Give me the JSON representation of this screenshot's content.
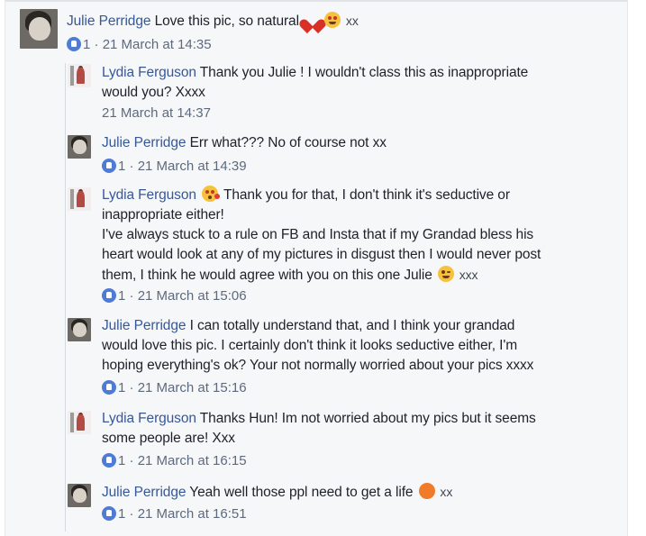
{
  "comments": [
    {
      "author": "Julie Perridge",
      "text": " Love this pic, so natural ",
      "trail": " xx",
      "likes": "1",
      "time": "21 March at 14:35"
    },
    {
      "author": "Lydia Ferguson",
      "line1": " Thank you Julie ! I wouldn't class this as inappropriate",
      "line2": "would you? Xxxx",
      "time": "21 March at 14:37"
    },
    {
      "author": "Julie Perridge",
      "text": " Err what??? No of course not xx",
      "likes": "1",
      "time": "21 March at 14:39"
    },
    {
      "author": "Lydia Ferguson",
      "line1": " Thank you for that, I don't think it's seductive or",
      "line2": "inappropriate either!",
      "line3": "I've always stuck to a rule on FB and Insta that if my Grandad bless his",
      "line4": "heart would look at any of my pictures in disgust then I would never post",
      "line5": "them, I think he would agree with you on this one Julie ",
      "line5_trail": " xxx",
      "likes": "1",
      "time": "21 March at 15:06"
    },
    {
      "author": "Julie Perridge",
      "line1": " I can totally understand that, and I think your grandad",
      "line2": "would love this pic. I certainly don't think it looks seductive either, I'm",
      "line3": "hoping everything's ok? Your not normally worried about your pics xxxx",
      "likes": "1",
      "time": "21 March at 15:16"
    },
    {
      "author": "Lydia Ferguson",
      "line1": " Thanks Hun! Im not worried about my pics but it seems",
      "line2": "some people are! Xxx",
      "likes": "1",
      "time": "21 March at 16:15"
    },
    {
      "author": "Julie Perridge",
      "text": " Yeah well those ppl need to get a life ",
      "trail": " xx",
      "likes": "1",
      "time": "21 March at 16:51"
    }
  ],
  "meta_separator": " · ",
  "icons": {
    "like": "like-badge-icon",
    "heart": "red-heart-emoji",
    "heart_eyes": "heart-eyes-emoji",
    "kiss": "face-blowing-kiss-emoji",
    "wink": "winking-face-emoji",
    "angry": "pouting-face-emoji"
  },
  "colors": {
    "name": "#365899",
    "meta": "#5d6a7e",
    "like": "#4d7bd6"
  }
}
